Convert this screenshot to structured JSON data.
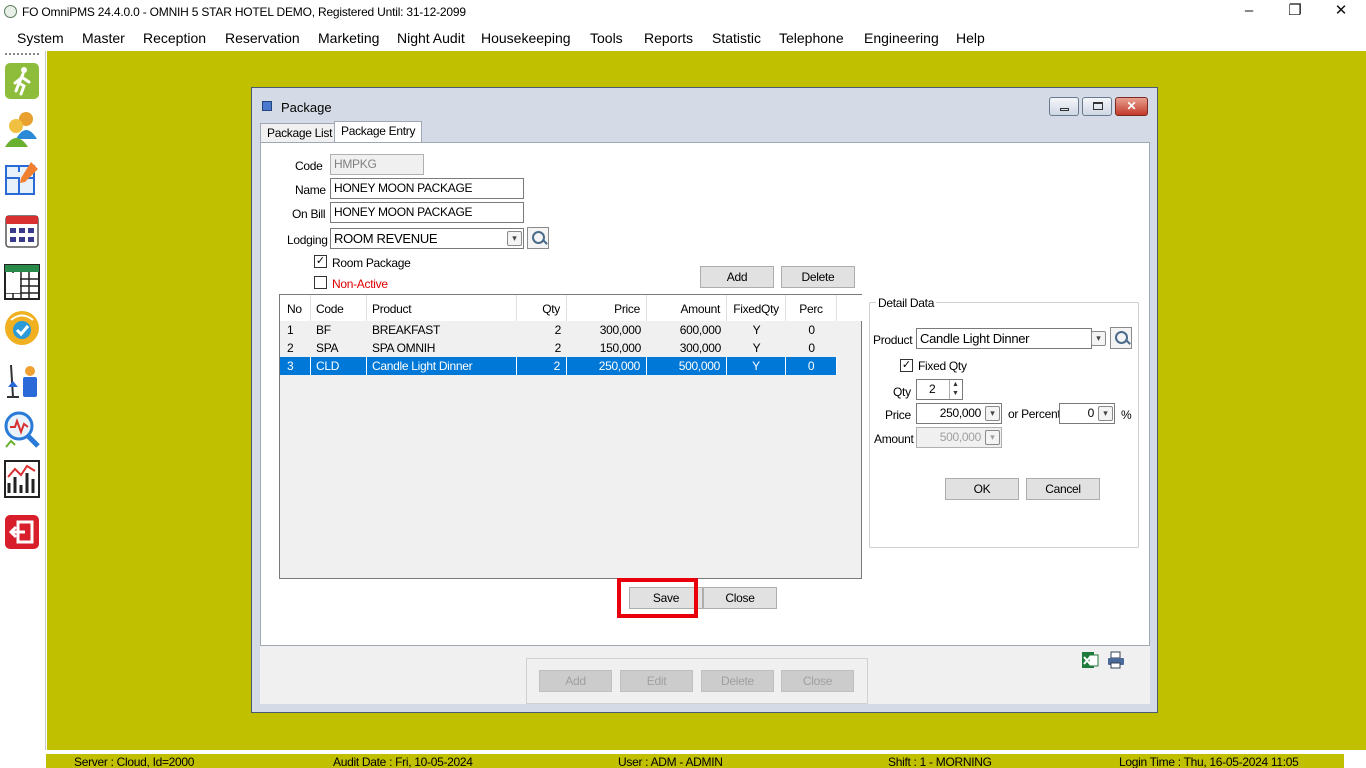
{
  "window": {
    "title": "FO OmniPMS 24.4.0.0 - OMNIH 5 STAR HOTEL DEMO, Registered Until: 31-12-2099",
    "minimize": "–",
    "restore": "❐",
    "close": "✕"
  },
  "menu": [
    "System",
    "Master",
    "Reception",
    "Reservation",
    "Marketing",
    "Night Audit",
    "Housekeeping",
    "Tools",
    "Reports",
    "Statistic",
    "Telephone",
    "Engineering",
    "Help"
  ],
  "sidebar_icons": [
    "walk-in-icon",
    "guests-icon",
    "floor-plan-icon",
    "calendar-icon",
    "schedule-icon",
    "availability-icon",
    "housekeeping-icon",
    "search-analysis-icon",
    "chart-icon",
    "exit-icon"
  ],
  "dialog": {
    "title": "Package",
    "tabs": [
      "Package List",
      "Package Entry"
    ],
    "active_tab": "Package Entry",
    "labels": {
      "code": "Code",
      "name": "Name",
      "on_bill": "On Bill",
      "lodging": "Lodging"
    },
    "code": "HMPKG",
    "name": "HONEY MOON PACKAGE",
    "on_bill": "HONEY MOON PACKAGE",
    "lodging": "ROOM REVENUE",
    "room_package_label": "Room Package",
    "room_package_checked": true,
    "non_active_label": "Non-Active",
    "non_active_checked": false,
    "add_label": "Add",
    "delete_label": "Delete",
    "grid": {
      "columns": [
        "No",
        "Code",
        "Product",
        "Qty",
        "Price",
        "Amount",
        "FixedQty",
        "Perc"
      ],
      "rows": [
        [
          "1",
          "BF",
          "BREAKFAST",
          "2",
          "300,000",
          "600,000",
          "Y",
          "0"
        ],
        [
          "2",
          "SPA",
          "SPA OMNIH",
          "2",
          "150,000",
          "300,000",
          "Y",
          "0"
        ],
        [
          "3",
          "CLD",
          "Candle Light Dinner",
          "2",
          "250,000",
          "500,000",
          "Y",
          "0"
        ]
      ],
      "selected_row": 3
    },
    "detail": {
      "group_label": "Detail Data",
      "product_label": "Product",
      "product": "Candle Light Dinner",
      "fixed_qty_label": "Fixed Qty",
      "fixed_qty_checked": true,
      "qty_label": "Qty",
      "qty": "2",
      "price_label": "Price",
      "price": "250,000",
      "or_percent_label": "or Percent",
      "percent": "0",
      "percent_sign": "%",
      "amount_label": "Amount",
      "amount": "500,000",
      "ok_label": "OK",
      "cancel_label": "Cancel"
    },
    "save_label": "Save",
    "close_label": "Close",
    "bottom_buttons": [
      "Add",
      "Edit",
      "Delete",
      "Close"
    ],
    "bottom_icons": [
      "excel-export-icon",
      "print-icon"
    ]
  },
  "status": {
    "server": "Server : Cloud, Id=2000",
    "audit_date": "Audit Date : Fri, 10-05-2024",
    "user": "User : ADM - ADMIN",
    "shift": "Shift : 1 - MORNING",
    "login_time": "Login Time : Thu, 16-05-2024 11:05"
  },
  "colors": {
    "workspace": "#c0c000",
    "selection": "#0078d7",
    "highlight": "#e8000b",
    "non_active": "#e00000"
  }
}
